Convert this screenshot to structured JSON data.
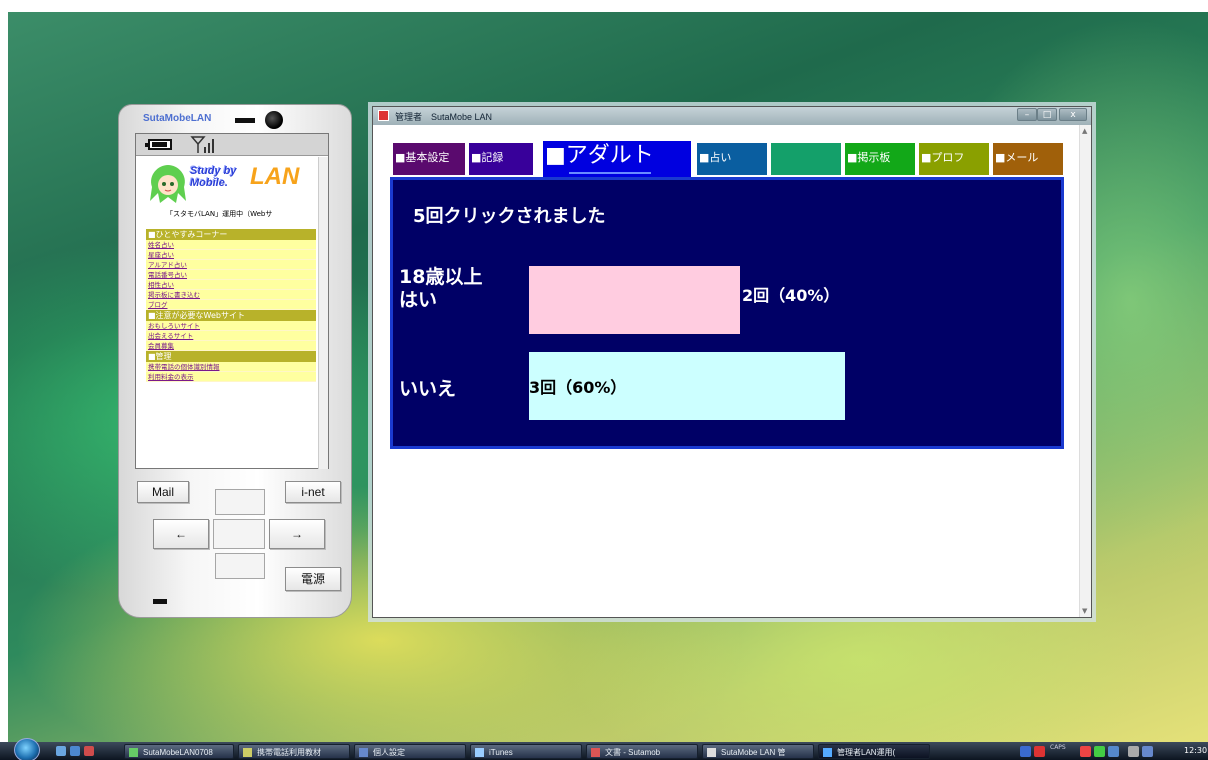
{
  "phone": {
    "title": "SutaMobeLAN",
    "logo": {
      "study": "Study by",
      "mobile": "Mobile.",
      "lan": "LAN"
    },
    "tagline": "「スタモバLAN」運用中（Webサ",
    "menu": [
      {
        "header": "■ひとやすみコーナー",
        "links": [
          "姓名占い",
          "星座占い",
          "アルアド占い",
          "電話番号占い",
          "相性占い",
          "掲示板に書き込む",
          "ブログ"
        ]
      },
      {
        "header": "■注意が必要なWebサイト",
        "links": [
          "おもしろいサイト",
          "出会えるサイト",
          "会員募集"
        ]
      },
      {
        "header": "■管理",
        "links": [
          "携帯電話の個体識別情報",
          "利用料金の表示"
        ]
      }
    ],
    "buttons": {
      "mail": "Mail",
      "inet": "i-net",
      "left": "←",
      "right": "→",
      "power": "電源"
    }
  },
  "window": {
    "title": "管理者　SutaMobe LAN",
    "controls": {
      "minimize": "–",
      "maximize": "□",
      "close": "x"
    },
    "tabs": [
      {
        "label": "■基本設定",
        "color": "#5a0a6e"
      },
      {
        "label": "■記録",
        "color": "#38009a"
      },
      {
        "label": "■アダルト",
        "color": "#0000e0",
        "active": true
      },
      {
        "label": "■占い",
        "color": "#0a5ea0"
      },
      {
        "label": "",
        "color": "#14a06a",
        "sub": ""
      },
      {
        "label": "■掲示板",
        "color": "#12a818"
      },
      {
        "label": "■プロフ",
        "color": "#8aa000"
      },
      {
        "label": "■メール",
        "color": "#a0600a"
      }
    ],
    "panel": {
      "clicks_text": "5回クリックされました",
      "questions": [
        {
          "label_line1": "18歳以上",
          "label_line2": "はい",
          "value_text": "2回（40%）",
          "fraction": 0.4,
          "color": "#ffcce0"
        },
        {
          "label_line1": "いいえ",
          "label_line2": "",
          "value_text": "3回（60%）",
          "fraction": 0.6,
          "color": "#ccffff"
        }
      ]
    }
  },
  "taskbar": {
    "items": [
      {
        "label": "SutaMobeLAN0708"
      },
      {
        "label": "携帯電話利用教材"
      },
      {
        "label": "個人設定"
      },
      {
        "label": "iTunes"
      },
      {
        "label": "文書 - Sutamob"
      },
      {
        "label": "SutaMobe LAN 管"
      },
      {
        "label": "管理者LAN運用(",
        "active": true
      }
    ],
    "tray_text": "CAPS",
    "clock": "12:30"
  }
}
